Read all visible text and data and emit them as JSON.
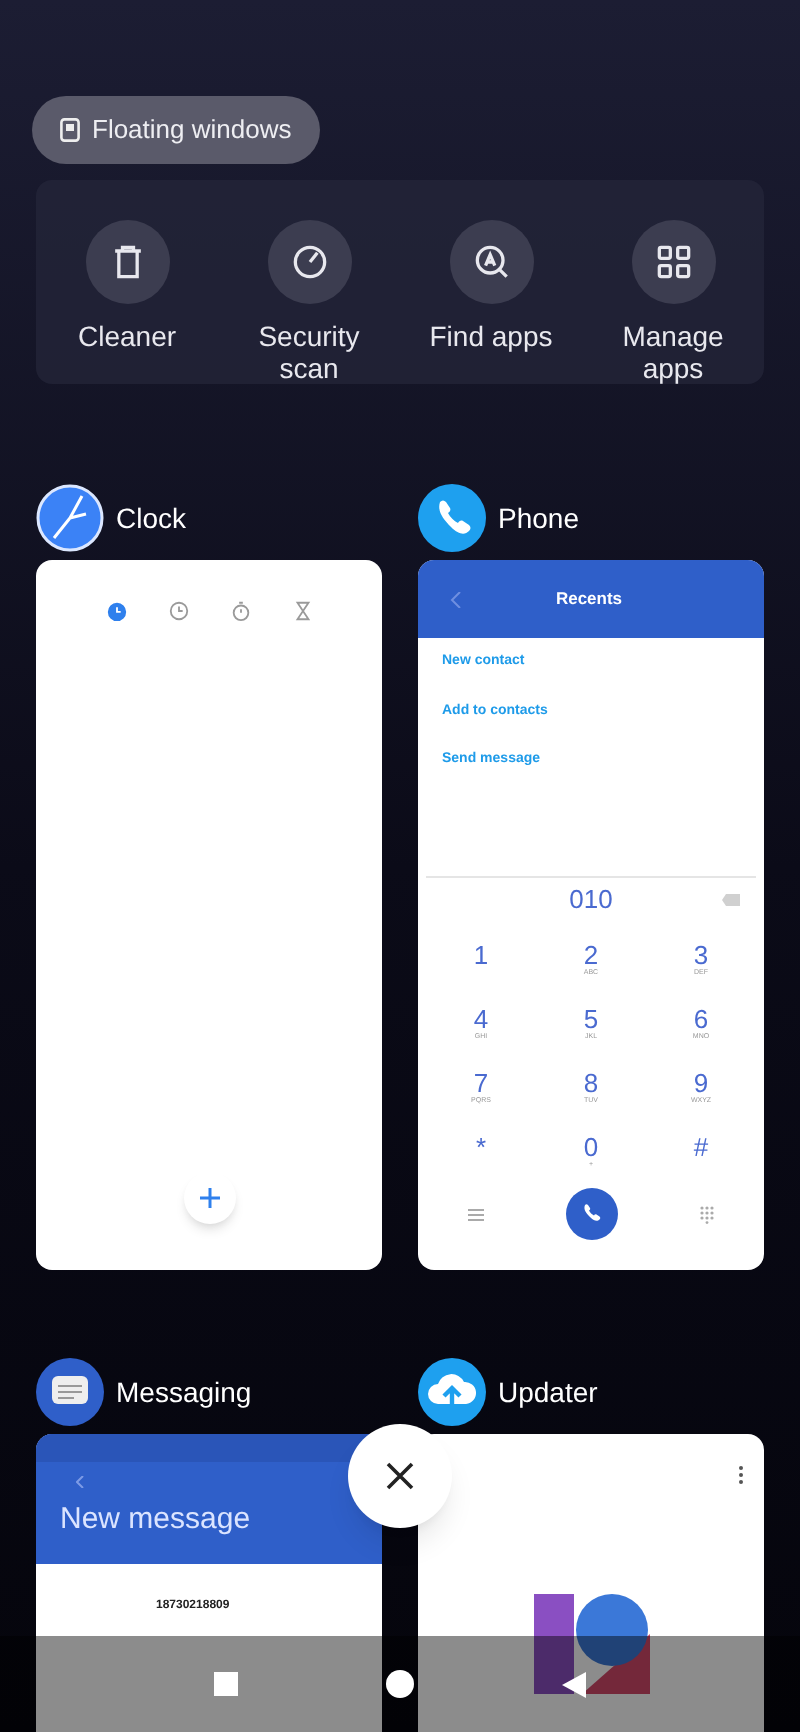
{
  "floating_button": {
    "label": "Floating windows"
  },
  "quick_actions": [
    {
      "kind": "cleaner",
      "label": "Cleaner"
    },
    {
      "kind": "scan",
      "label": "Security scan"
    },
    {
      "kind": "find",
      "label": "Find apps"
    },
    {
      "kind": "manage",
      "label": "Manage apps"
    }
  ],
  "recent_apps": [
    {
      "kind": "clock",
      "name": "Clock",
      "tabs": [
        {
          "kind": "alarm",
          "selected": true
        },
        {
          "kind": "clock",
          "selected": false
        },
        {
          "kind": "stopwatch",
          "selected": false
        },
        {
          "kind": "timer",
          "selected": false
        }
      ]
    },
    {
      "kind": "phone",
      "name": "Phone",
      "title": "Recents",
      "links": [
        "New contact",
        "Add to contacts",
        "Send message"
      ],
      "number": "010",
      "keys": [
        {
          "digit": "1"
        },
        {
          "digit": "2",
          "letters": "ABC"
        },
        {
          "digit": "3",
          "letters": "DEF"
        },
        {
          "digit": "4",
          "letters": "GHI"
        },
        {
          "digit": "5",
          "letters": "JKL"
        },
        {
          "digit": "6",
          "letters": "MNO"
        },
        {
          "digit": "7",
          "letters": "PQRS"
        },
        {
          "digit": "8",
          "letters": "TUV"
        },
        {
          "digit": "9",
          "letters": "WXYZ"
        },
        {
          "digit": "*"
        },
        {
          "digit": "0",
          "letters": "+"
        },
        {
          "digit": "#"
        }
      ]
    },
    {
      "kind": "messaging",
      "name": "Messaging",
      "title": "New message",
      "number": "18730218809"
    },
    {
      "kind": "updater",
      "name": "Updater"
    }
  ]
}
